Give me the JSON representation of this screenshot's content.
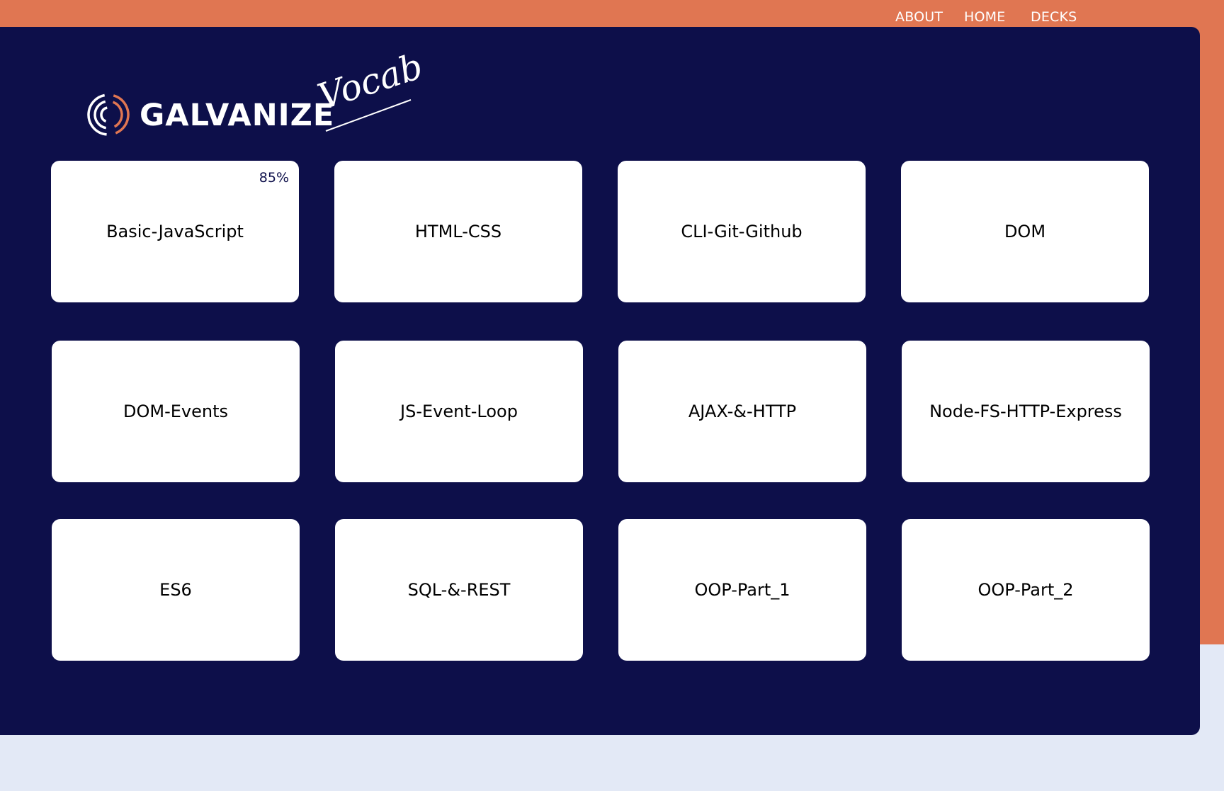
{
  "nav": {
    "about": "ABOUT",
    "home": "HOME",
    "decks": "DECKS"
  },
  "logo": {
    "wordmark": "GALVANIZE",
    "script": "Vocab"
  },
  "colors": {
    "orange": "#e07652",
    "navy": "#0d0f4a",
    "page_bg": "#e3e9f6",
    "card_bg": "#ffffff"
  },
  "decks": [
    {
      "label": "Basic-JavaScript",
      "progress": "85%"
    },
    {
      "label": "HTML-CSS"
    },
    {
      "label": "CLI-Git-Github"
    },
    {
      "label": "DOM"
    },
    {
      "label": "DOM-Events"
    },
    {
      "label": "JS-Event-Loop"
    },
    {
      "label": "AJAX-&-HTTP"
    },
    {
      "label": "Node-FS-HTTP-Express"
    },
    {
      "label": "ES6"
    },
    {
      "label": "SQL-&-REST"
    },
    {
      "label": "OOP-Part_1"
    },
    {
      "label": "OOP-Part_2"
    }
  ]
}
